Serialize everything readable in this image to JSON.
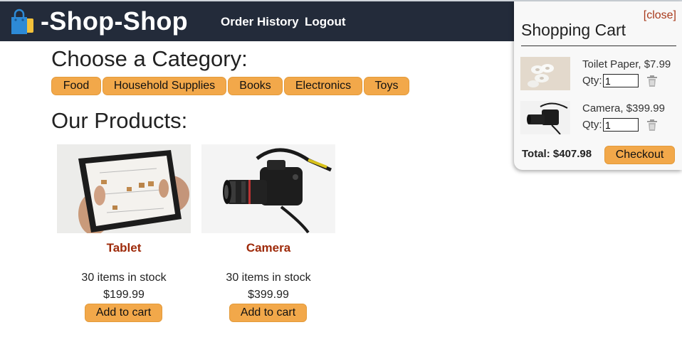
{
  "header": {
    "brand": "-Shop-Shop",
    "logo_icon": "shopping-bags-icon",
    "nav": [
      {
        "label": "Order History"
      },
      {
        "label": "Logout"
      }
    ]
  },
  "categories": {
    "title": "Choose a Category:",
    "items": [
      {
        "label": "Food"
      },
      {
        "label": "Household Supplies"
      },
      {
        "label": "Books"
      },
      {
        "label": "Electronics"
      },
      {
        "label": "Toys"
      }
    ]
  },
  "products": {
    "title": "Our Products:",
    "items": [
      {
        "name": "Tablet",
        "stock": "30 items in stock",
        "price": "$199.99",
        "button": "Add to cart"
      },
      {
        "name": "Camera",
        "stock": "30 items in stock",
        "price": "$399.99",
        "button": "Add to cart"
      }
    ]
  },
  "cart": {
    "close_label": "[close]",
    "title": "Shopping Cart",
    "items": [
      {
        "desc": "Toilet Paper, $7.99",
        "qty_label": "Qty:",
        "qty": "1"
      },
      {
        "desc": "Camera, $399.99",
        "qty_label": "Qty:",
        "qty": "1"
      }
    ],
    "total": "Total: $407.98",
    "checkout_label": "Checkout"
  },
  "colors": {
    "header_bg": "#232b3a",
    "button": "#f2a84a",
    "product_name": "#9e2a0a"
  }
}
